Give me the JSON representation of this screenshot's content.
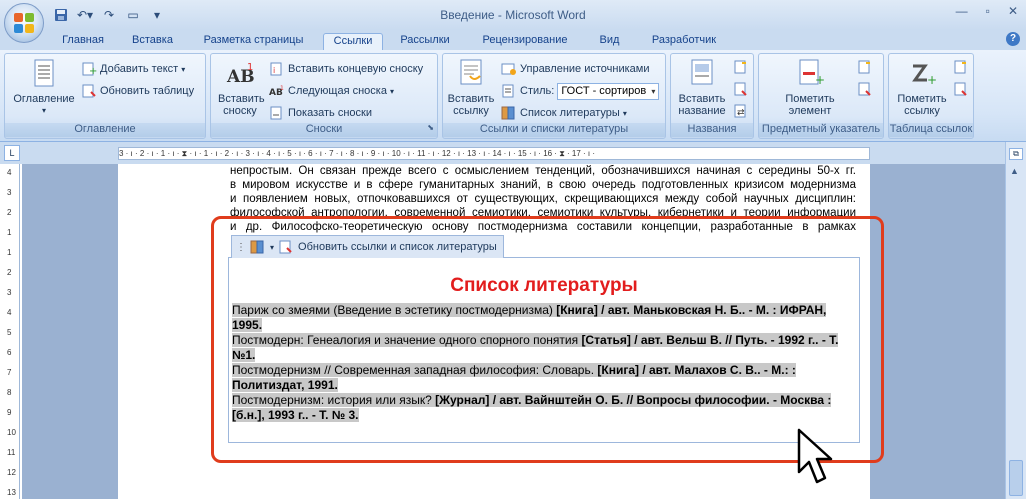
{
  "window": {
    "title": "Введение - Microsoft Word"
  },
  "tabs": [
    "Главная",
    "Вставка",
    "Разметка страницы",
    "Ссылки",
    "Рассылки",
    "Рецензирование",
    "Вид",
    "Разработчик"
  ],
  "active_tab": "Ссылки",
  "ribbon": {
    "toc": {
      "group_label": "Оглавление",
      "toc_button": "Оглавление",
      "add_text": "Добавить текст",
      "update_table": "Обновить таблицу"
    },
    "footnotes": {
      "group_label": "Сноски",
      "insert_footnote": "Вставить сноску",
      "insert_endnote": "Вставить концевую сноску",
      "next_footnote": "Следующая сноска",
      "show_notes": "Показать сноски"
    },
    "citations": {
      "group_label": "Ссылки и списки литературы",
      "insert_citation": "Вставить ссылку",
      "manage_sources": "Управление источниками",
      "style_label": "Стиль:",
      "style_value": "ГОСТ - сортиров",
      "bibliography": "Список литературы"
    },
    "captions": {
      "group_label": "Названия",
      "insert_caption": "Вставить название"
    },
    "index": {
      "group_label": "Предметный указатель",
      "mark_entry": "Пометить элемент"
    },
    "authorities": {
      "group_label": "Таблица ссылок",
      "mark_citation": "Пометить ссылку"
    }
  },
  "ruler": {
    "h_marks": "3 · ı · 2 · ı · 1 · ı · ⧗ · ı · 1 · ı · 2 · ı · 3 · ı · 4 · ı · 5 · ı · 6 · ı · 7 · ı · 8 · ı · 9 · ı · 10 · ı · 11 · ı · 12 · ı · 13 · ı · 14 · ı · 15 · ı · 16 · ⧗ · 17 · ı ·",
    "v_marks": [
      "4",
      "3",
      "2",
      "1",
      "1",
      "2",
      "3",
      "4",
      "5",
      "6",
      "7",
      "8",
      "9",
      "10",
      "11",
      "12",
      "13"
    ]
  },
  "document": {
    "paragraph_lines": [
      "непростым. Он связан прежде всего с осмыслением тенденций, обозначившихся начиная с середины 50-х гг.",
      "в мировом искусстве и в сфере гуманитарных знаний, в свою очередь подготовленных кризисом модернизма",
      "и появлением новых, отпочковавшихся от существующих, скрещивающихся между собой научных дисциплин:",
      "философской антропологии, современной семиотики, семиотики культуры, кибернетики и теории информации",
      "и др. Философско-теоретическую основу постмодернизма составили концепции, разработанные в рамках"
    ],
    "content_control_tab": "Обновить ссылки и список литературы",
    "bibliography_title": "Список литературы",
    "entries": [
      {
        "plain": "Париж со змеями (Введение в эстетику постмодернизма) ",
        "bold": "[Книга] / авт. Маньковская Н. Б.. - М. : ИФРАН, 1995."
      },
      {
        "plain": "Постмодерн: Генеалогия и значение одного спорного понятия ",
        "bold": "[Статья] / авт. Вельш В. // Путь. - 1992 г.. - Т. №1."
      },
      {
        "plain": "Постмодернизм // Современная западная философия: Словарь. ",
        "bold": "[Книга] / авт. Малахов С. В.. - М.: : Политиздат, 1991."
      },
      {
        "plain": "Постмодернизм: история или язык? ",
        "bold": "[Журнал] / авт. Вайнштейн О. Б. // Вопросы философии. - Москва : [б.н.], 1993 г.. - Т. № 3."
      }
    ]
  },
  "colors": {
    "highlight_frame": "#e03c1c",
    "bibliography_title": "#e21d1d",
    "field_shading": "#c8c8c8"
  }
}
